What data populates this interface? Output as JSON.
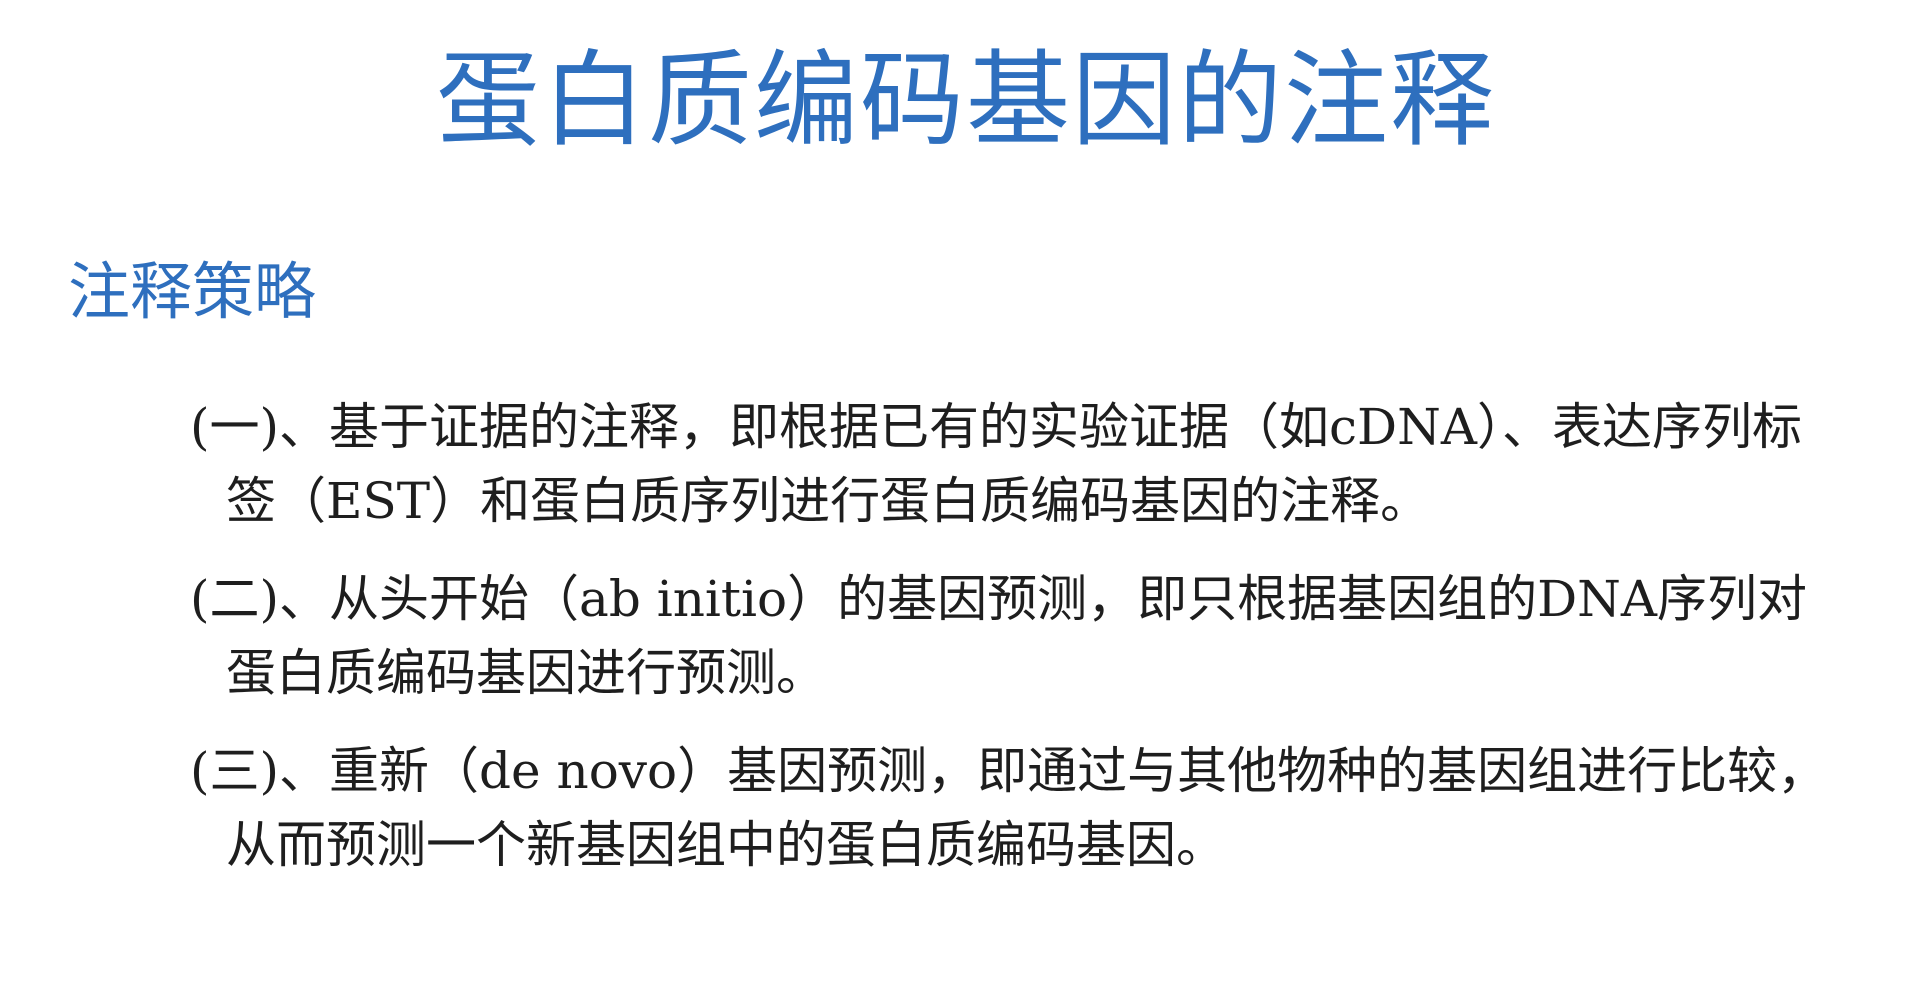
{
  "slide": {
    "title": "蛋白质编码基因的注释",
    "subtitle": "注释策略",
    "items": [
      "(一)、基于证据的注释，即根据已有的实验证据（如cDNA）、表达序列标签（EST）和蛋白质序列进行蛋白质编码基因的注释。",
      "(二)、从头开始（ab initio）的基因预测，即只根据基因组的DNA序列对蛋白质编码基因进行预测。",
      "(三)、重新（de novo）基因预测，即通过与其他物种的基因组进行比较，从而预测一个新基因组中的蛋白质编码基因。"
    ]
  },
  "colors": {
    "heading": "#2e6fbe",
    "body_text": "#1e1e1e",
    "background": "#ffffff"
  }
}
